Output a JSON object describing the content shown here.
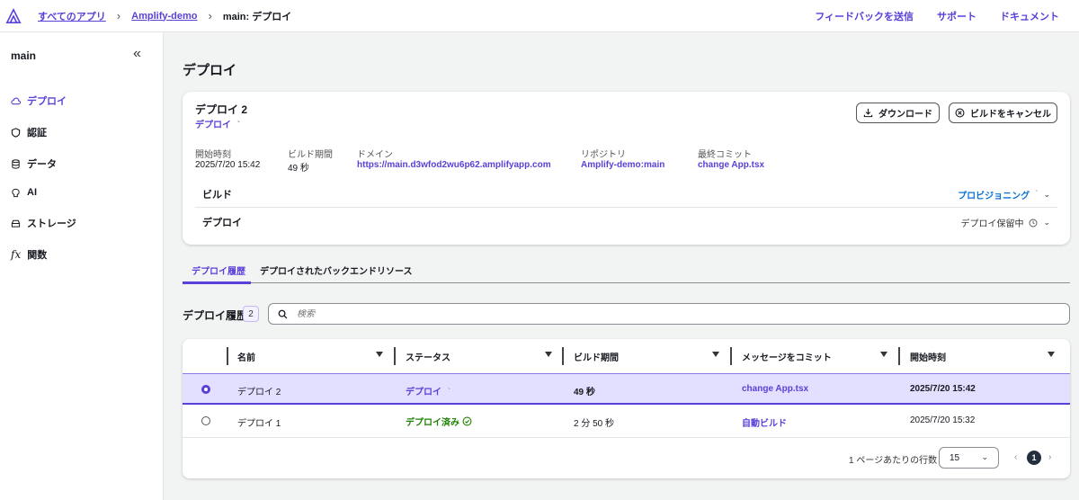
{
  "breadcrumb": {
    "items": [
      "すべてのアプリ",
      "Amplify-demo"
    ],
    "current": "main: デプロイ"
  },
  "top_links": [
    "フィードバックを送信",
    "サポート",
    "ドキュメント"
  ],
  "sidebar": {
    "title": "main",
    "items": [
      {
        "label": "デプロイ",
        "icon": "cloud-icon",
        "active": true
      },
      {
        "label": "認証",
        "icon": "shield-icon"
      },
      {
        "label": "データ",
        "icon": "database-icon"
      },
      {
        "label": "AI",
        "icon": "brain-icon"
      },
      {
        "label": "ストレージ",
        "icon": "storage-icon"
      },
      {
        "label": "関数",
        "icon": "function-icon"
      }
    ]
  },
  "page_title": "デプロイ",
  "deploy_card": {
    "title": "デプロイ 2",
    "status": "デプロイ",
    "download_label": "ダウンロード",
    "cancel_label": "ビルドをキャンセル",
    "meta": [
      {
        "label": "開始時刻",
        "value": "2025/7/20 15:42"
      },
      {
        "label": "ビルド期間",
        "value": "49 秒"
      },
      {
        "label": "ドメイン",
        "value": "https://main.d3wfod2wu6p62.amplifyapp.com"
      },
      {
        "label": "リポジトリ",
        "value": "Amplify-demo:main"
      },
      {
        "label": "最終コミット",
        "value": "change App.tsx"
      }
    ],
    "steps": [
      {
        "label": "ビルド",
        "status": "プロビジョニング"
      },
      {
        "label": "デプロイ",
        "status": "デプロイ保留中"
      }
    ]
  },
  "tabs": [
    "デプロイ履歴",
    "デプロイされたバックエンドリソース"
  ],
  "history": {
    "title": "デプロイ履歴",
    "count": "2",
    "search_placeholder": "検索",
    "columns": [
      "名前",
      "ステータス",
      "ビルド期間",
      "メッセージをコミット",
      "開始時刻"
    ],
    "rows": [
      {
        "name": "デプロイ 2",
        "status": "デプロイ",
        "duration": "49 秒",
        "commit": "change App.tsx",
        "start": "2025/7/20 15:42",
        "selected": true
      },
      {
        "name": "デプロイ 1",
        "status": "デプロイ済み",
        "duration": "2 分 50 秒",
        "commit": "自動ビルド",
        "start": "2025/7/20 15:32",
        "selected": false
      }
    ],
    "rows_per_page_label": "1 ページあたりの行数",
    "rows_per_page": "15",
    "current_page": "1"
  },
  "colors": {
    "accent": "#5a3fd8",
    "success": "#1d8102",
    "selected_row": "#e3dfff"
  }
}
